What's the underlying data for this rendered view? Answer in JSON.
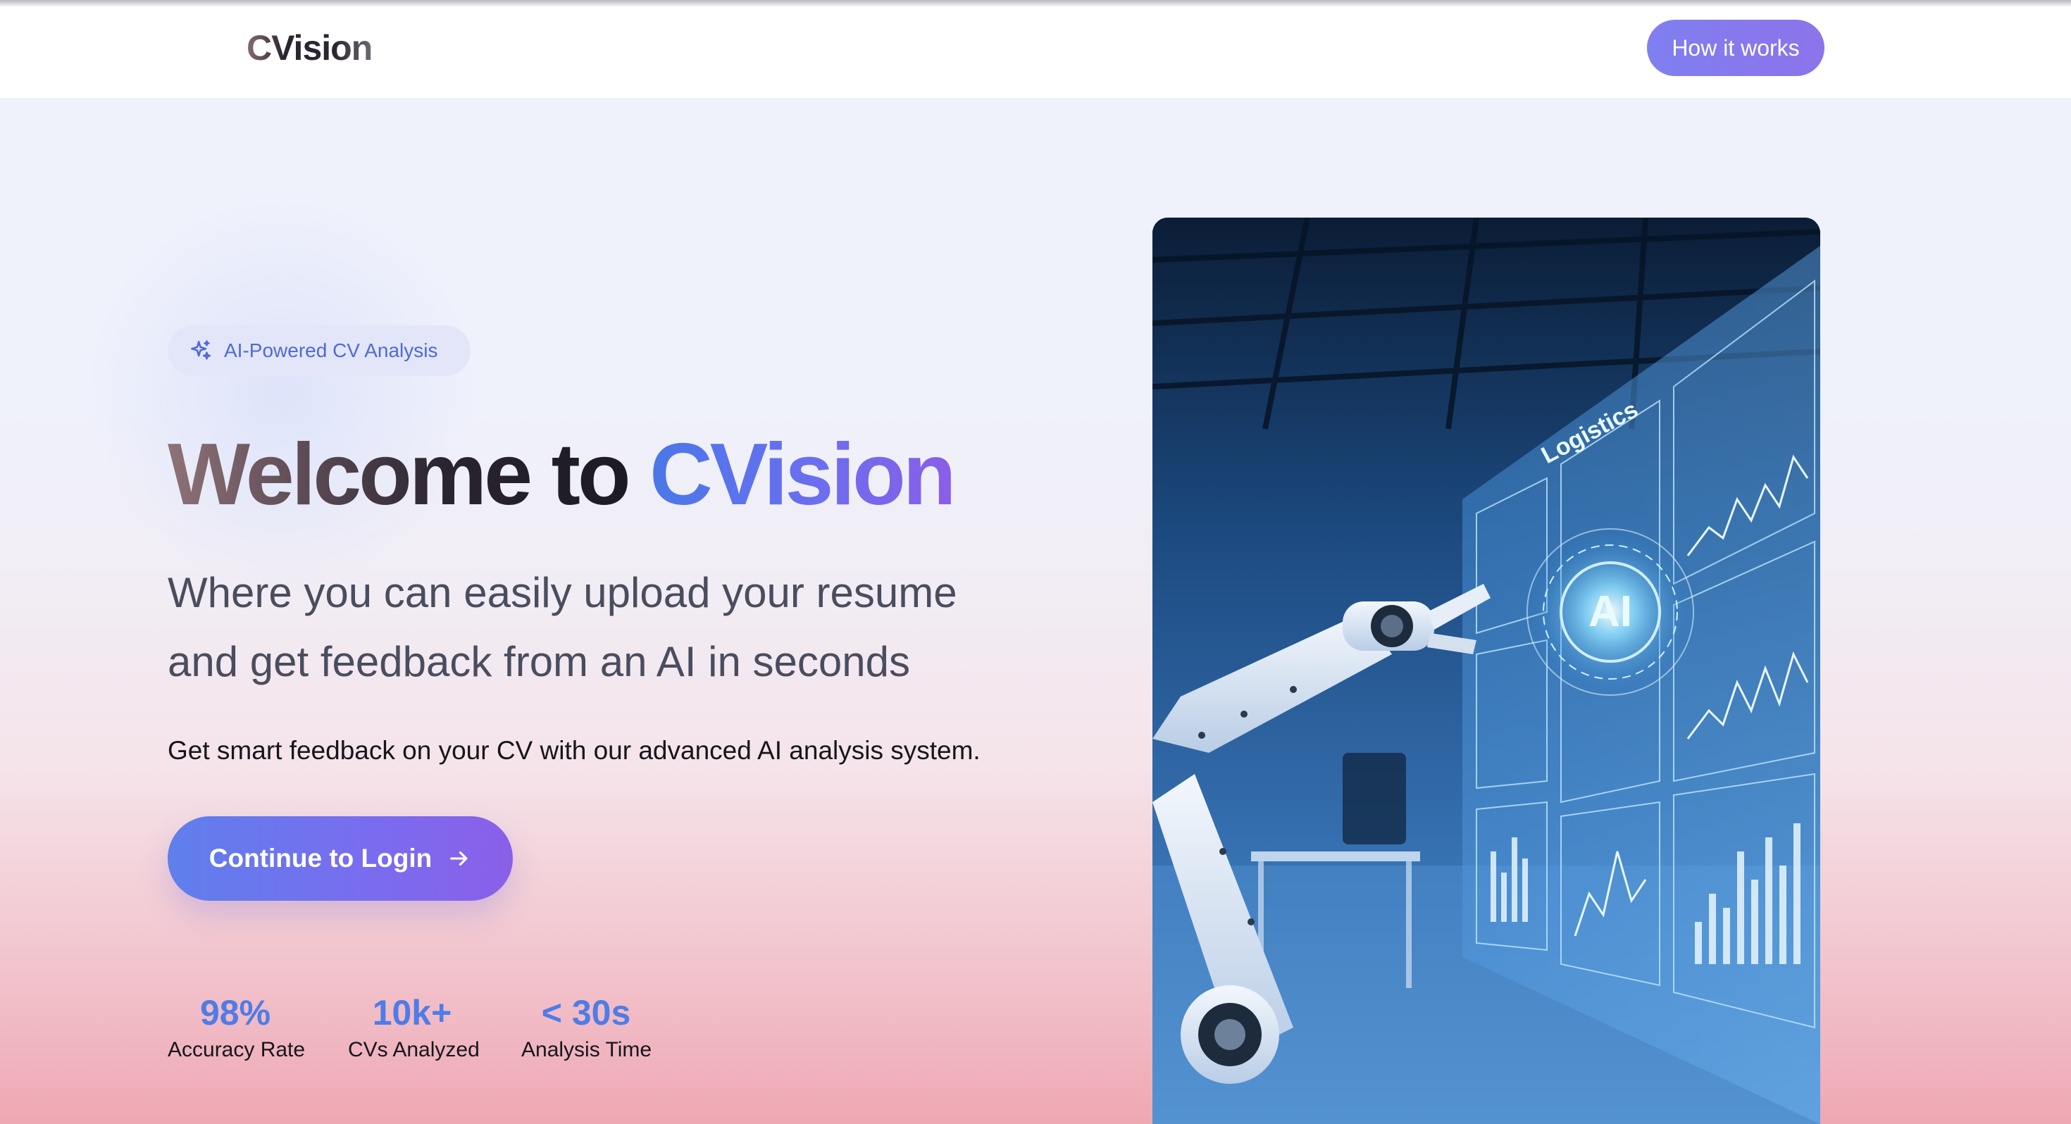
{
  "header": {
    "logo": "CVision",
    "how_button": "How it works"
  },
  "hero": {
    "badge": "AI-Powered CV Analysis",
    "title_part1": "Welcome to",
    "title_part2": "CVision",
    "subtitle_line1": "Where you can easily upload your resume",
    "subtitle_line2": "and get feedback from an AI in seconds",
    "description": "Get smart feedback on your CV with our advanced AI analysis system.",
    "cta": "Continue to Login",
    "stats": [
      {
        "value": "98%",
        "label": "Accuracy Rate"
      },
      {
        "value": "10k+",
        "label": "CVs Analyzed"
      },
      {
        "value": "< 30s",
        "label": "Analysis Time"
      }
    ]
  },
  "image": {
    "screen_title": "Logistics",
    "screen_center": "AI"
  },
  "colors": {
    "accent": "#6b6ef0",
    "accent_blue": "#4f7ce6",
    "badge_bg": "#e2e6f8"
  },
  "icons": {
    "badge": "sparkle-icon",
    "cta": "arrow-right-icon"
  }
}
